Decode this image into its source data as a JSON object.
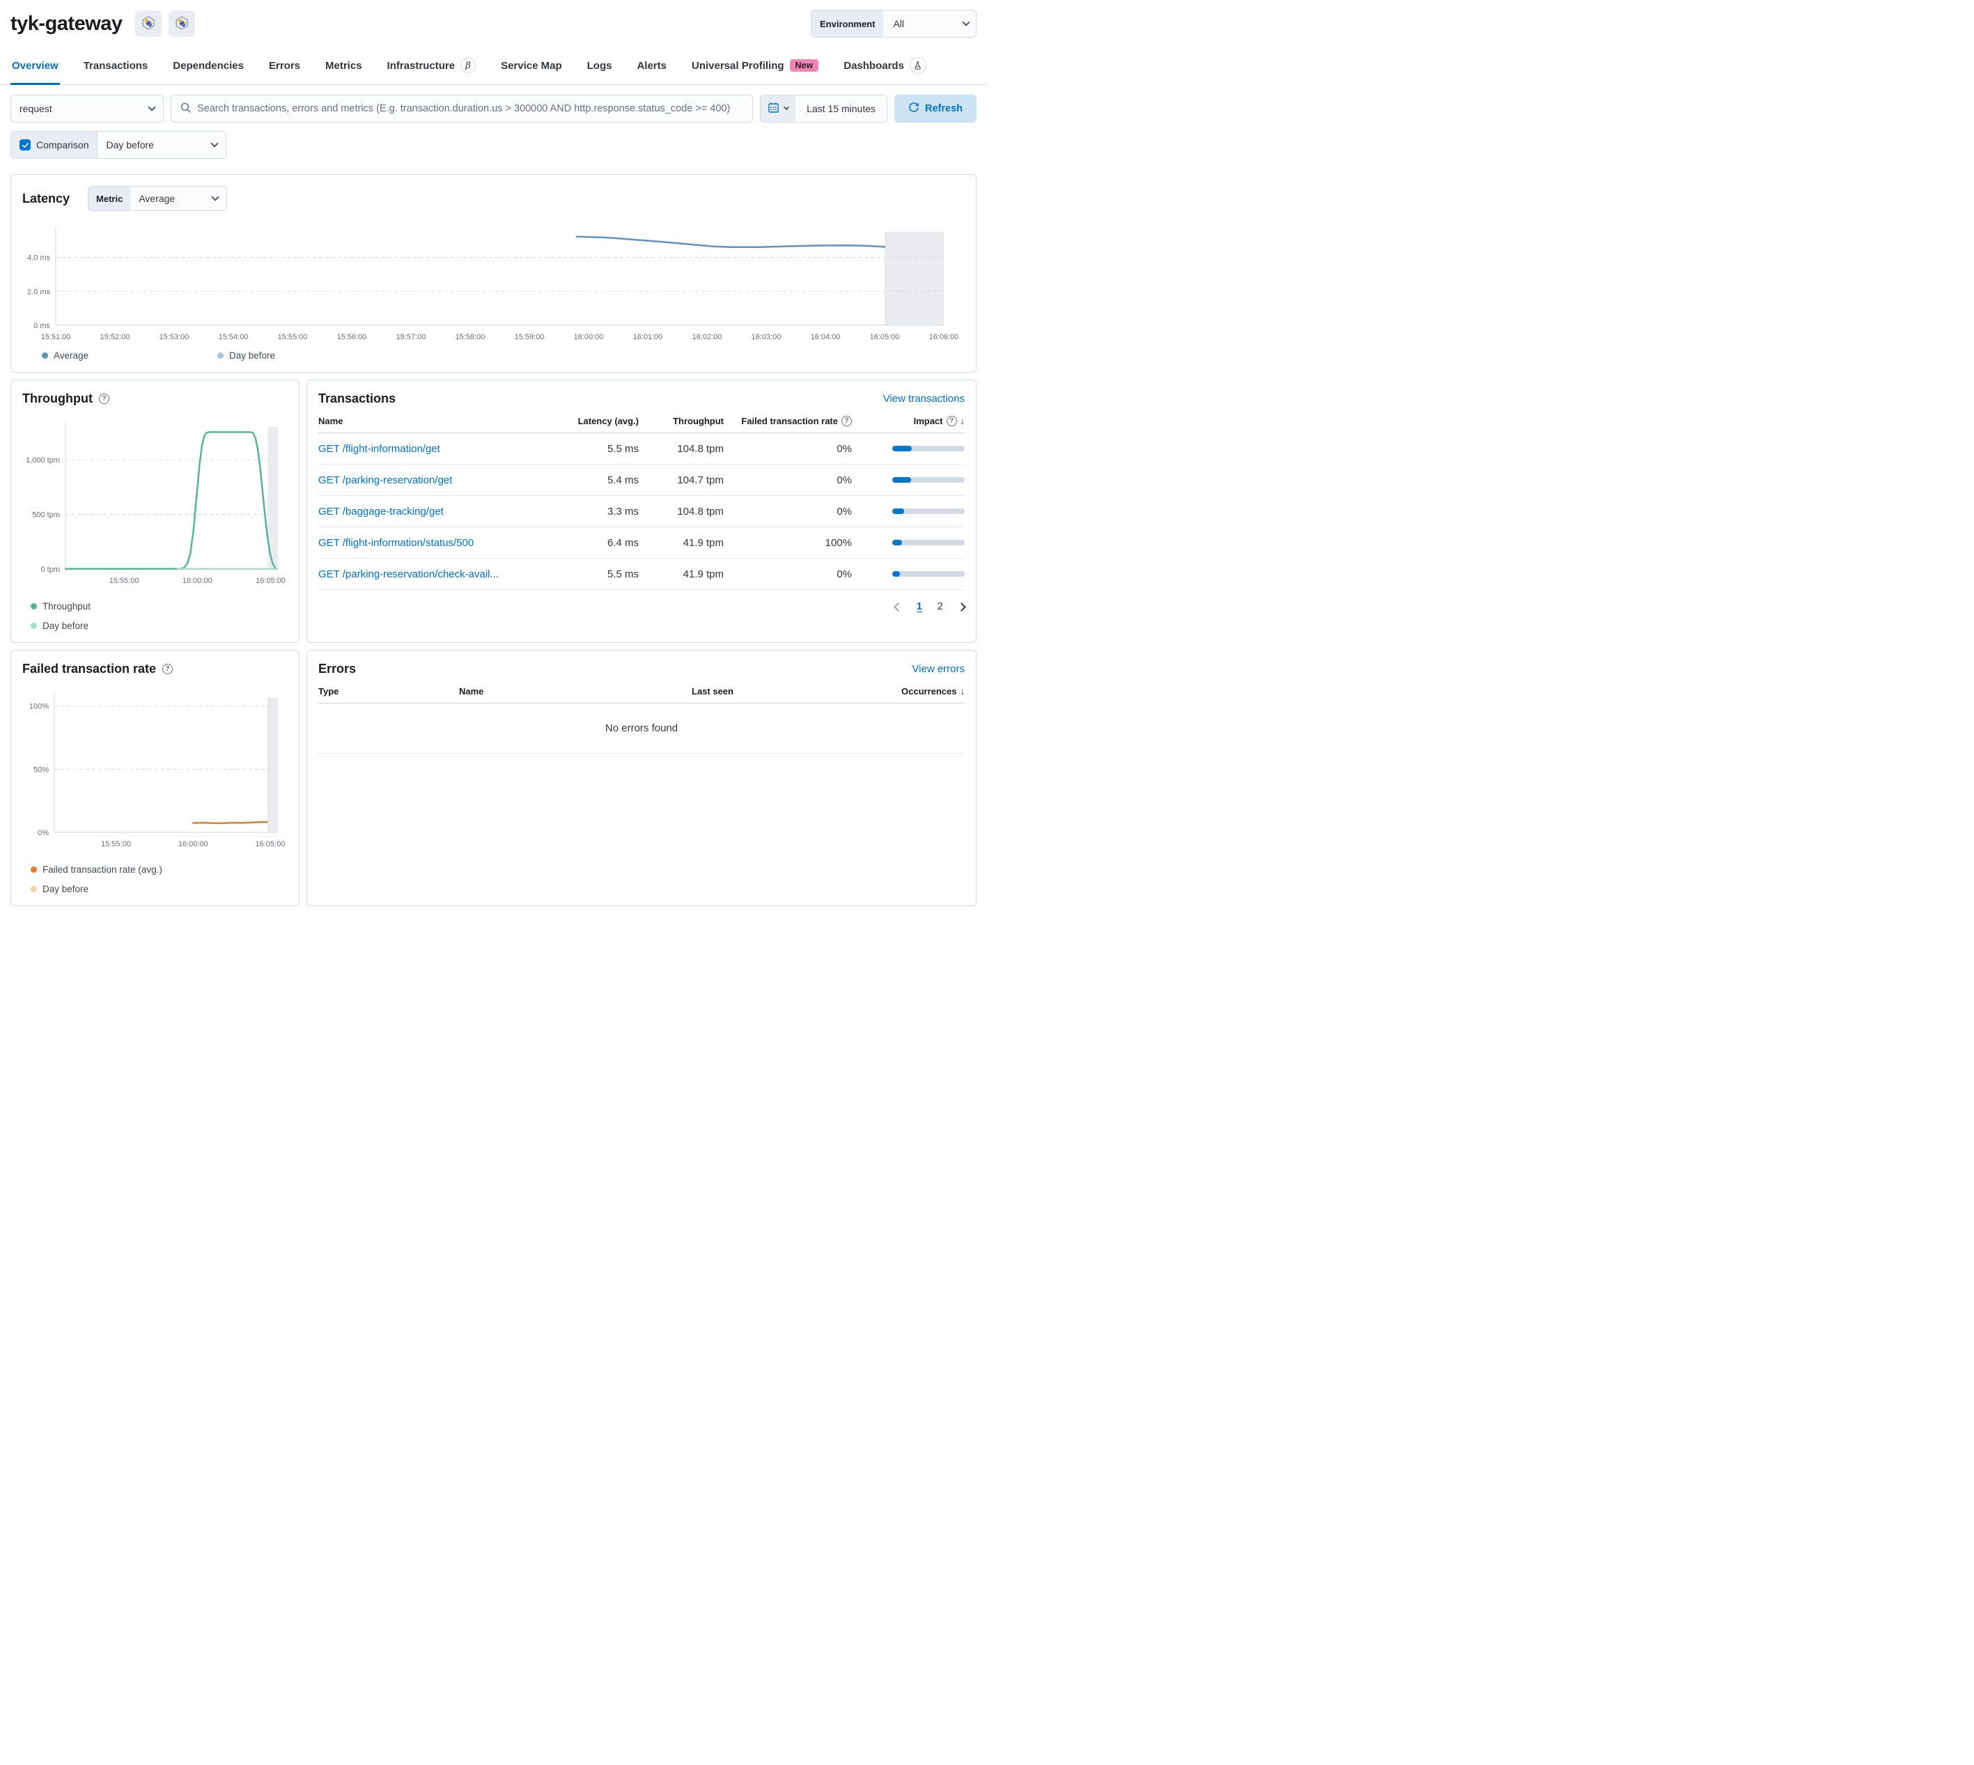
{
  "header": {
    "service_name": "tyk-gateway",
    "environment_label": "Environment",
    "environment_value": "All"
  },
  "tabs": [
    {
      "label": "Overview",
      "active": true
    },
    {
      "label": "Transactions"
    },
    {
      "label": "Dependencies"
    },
    {
      "label": "Errors"
    },
    {
      "label": "Metrics"
    },
    {
      "label": "Infrastructure",
      "beta_badge": "β"
    },
    {
      "label": "Service Map"
    },
    {
      "label": "Logs"
    },
    {
      "label": "Alerts"
    },
    {
      "label": "Universal Profiling",
      "new_badge": "New"
    },
    {
      "label": "Dashboards"
    }
  ],
  "filters": {
    "transaction_type_value": "request",
    "search_placeholder": "Search transactions, errors and metrics (E.g. transaction.duration.us > 300000 AND http.response.status_code >= 400)",
    "time_range_value": "Last 15 minutes",
    "refresh_label": "Refresh",
    "comparison_label": "Comparison",
    "comparison_checked": true,
    "comparison_value": "Day before"
  },
  "latency_panel": {
    "title": "Latency",
    "metric_label": "Metric",
    "metric_value": "Average"
  },
  "throughput_panel": {
    "title": "Throughput"
  },
  "transactions_panel": {
    "title": "Transactions",
    "view_link": "View transactions",
    "columns": {
      "name": "Name",
      "latency": "Latency (avg.)",
      "throughput": "Throughput",
      "failed_rate": "Failed transaction rate",
      "impact": "Impact"
    },
    "impact_bar_color": "#0077cc",
    "rows": [
      {
        "name": "GET /flight-information/get",
        "latency": "5.5 ms",
        "throughput": "104.8 tpm",
        "failed_rate": "0%",
        "impact_pct": 27
      },
      {
        "name": "GET /parking-reservation/get",
        "latency": "5.4 ms",
        "throughput": "104.7 tpm",
        "failed_rate": "0%",
        "impact_pct": 26
      },
      {
        "name": "GET /baggage-tracking/get",
        "latency": "3.3 ms",
        "throughput": "104.8 tpm",
        "failed_rate": "0%",
        "impact_pct": 16
      },
      {
        "name": "GET /flight-information/status/500",
        "latency": "6.4 ms",
        "throughput": "41.9 tpm",
        "failed_rate": "100%",
        "impact_pct": 13
      },
      {
        "name": "GET /parking-reservation/check-avail...",
        "latency": "5.5 ms",
        "throughput": "41.9 tpm",
        "failed_rate": "0%",
        "impact_pct": 11
      }
    ],
    "pagination": {
      "pages": [
        "1",
        "2"
      ],
      "active_page": "1"
    }
  },
  "failed_panel": {
    "title": "Failed transaction rate"
  },
  "errors_panel": {
    "title": "Errors",
    "view_link": "View errors",
    "columns": {
      "type": "Type",
      "name": "Name",
      "last_seen": "Last seen",
      "occurrences": "Occurrences"
    },
    "empty_message": "No errors found"
  },
  "chart_data": [
    {
      "id": "latency",
      "type": "line",
      "title": "Latency",
      "ylabel": "ms",
      "xlim": [
        0,
        900
      ],
      "ylim": [
        0,
        5.5
      ],
      "grid": "dashed-horizontal",
      "legend_position": "bottom",
      "yticks": [
        {
          "v": 0,
          "label": "0 ms"
        },
        {
          "v": 2,
          "label": "2.0 ms"
        },
        {
          "v": 4,
          "label": "4.0 ms"
        }
      ],
      "xticks": [
        {
          "v": 0,
          "label": "15:51:00"
        },
        {
          "v": 60,
          "label": "15:52:00"
        },
        {
          "v": 120,
          "label": "15:53:00"
        },
        {
          "v": 180,
          "label": "15:54:00"
        },
        {
          "v": 240,
          "label": "15:55:00"
        },
        {
          "v": 300,
          "label": "15:56:00"
        },
        {
          "v": 360,
          "label": "15:57:00"
        },
        {
          "v": 420,
          "label": "15:58:00"
        },
        {
          "v": 480,
          "label": "15:59:00"
        },
        {
          "v": 540,
          "label": "16:00:00"
        },
        {
          "v": 600,
          "label": "16:01:00"
        },
        {
          "v": 660,
          "label": "16:02:00"
        },
        {
          "v": 720,
          "label": "16:03:00"
        },
        {
          "v": 780,
          "label": "16:04:00"
        },
        {
          "v": 840,
          "label": "16:05:00"
        },
        {
          "v": 900,
          "label": "16:06:00"
        }
      ],
      "annotation_band": [
        840,
        900
      ],
      "series": [
        {
          "name": "Average",
          "color": "#6092c0",
          "points": [
            [
              528,
              5.22
            ],
            [
              558,
              5.17
            ],
            [
              588,
              5.04
            ],
            [
              618,
              4.9
            ],
            [
              648,
              4.74
            ],
            [
              666,
              4.65
            ],
            [
              684,
              4.61
            ],
            [
              714,
              4.61
            ],
            [
              744,
              4.66
            ],
            [
              774,
              4.7
            ],
            [
              804,
              4.71
            ],
            [
              824,
              4.68
            ],
            [
              840,
              4.62
            ]
          ]
        },
        {
          "name": "Day before",
          "color": "#a9c4df",
          "points": []
        }
      ]
    },
    {
      "id": "throughput",
      "type": "line",
      "title": "Throughput",
      "ylabel": "tpm",
      "xlim": [
        0,
        870
      ],
      "ylim": [
        0,
        1300
      ],
      "grid": "dashed-horizontal",
      "legend_position": "bottom",
      "yticks": [
        {
          "v": 0,
          "label": "0 tpm"
        },
        {
          "v": 500,
          "label": "500 tpm"
        },
        {
          "v": 1000,
          "label": "1,000 tpm"
        }
      ],
      "xticks": [
        {
          "v": 240,
          "label": "15:55:00"
        },
        {
          "v": 540,
          "label": "16:00:00"
        },
        {
          "v": 840,
          "label": "16:05:00"
        }
      ],
      "annotation_band": [
        828,
        870
      ],
      "series": [
        {
          "name": "Throughput",
          "color": "#54b399",
          "points": [
            [
              0,
              2
            ],
            [
              468,
              2
            ],
            [
              486,
              12
            ],
            [
              500,
              55
            ],
            [
              512,
              150
            ],
            [
              524,
              350
            ],
            [
              536,
              640
            ],
            [
              548,
              930
            ],
            [
              558,
              1120
            ],
            [
              568,
              1215
            ],
            [
              578,
              1248
            ],
            [
              592,
              1253
            ],
            [
              756,
              1253
            ],
            [
              768,
              1245
            ],
            [
              778,
              1200
            ],
            [
              788,
              1090
            ],
            [
              798,
              910
            ],
            [
              808,
              690
            ],
            [
              818,
              470
            ],
            [
              828,
              280
            ],
            [
              838,
              140
            ],
            [
              848,
              55
            ],
            [
              858,
              12
            ],
            [
              866,
              0
            ]
          ]
        },
        {
          "name": "Day before",
          "color": "#abdcc8",
          "points": [
            [
              462,
              1
            ],
            [
              866,
              1
            ]
          ]
        }
      ]
    },
    {
      "id": "failed_transaction_rate",
      "type": "line",
      "title": "Failed transaction rate",
      "ylabel": "%",
      "xlim": [
        0,
        870
      ],
      "ylim": [
        0,
        107
      ],
      "grid": "dashed-horizontal",
      "legend_position": "bottom",
      "yticks": [
        {
          "v": 0,
          "label": "0%"
        },
        {
          "v": 50,
          "label": "50%"
        },
        {
          "v": 100,
          "label": "100%"
        }
      ],
      "xticks": [
        {
          "v": 240,
          "label": "15:55:00"
        },
        {
          "v": 540,
          "label": "16:00:00"
        },
        {
          "v": 840,
          "label": "16:05:00"
        }
      ],
      "annotation_band": [
        828,
        870
      ],
      "series": [
        {
          "name": "Failed transaction rate (avg.)",
          "color": "#dd7e35",
          "points": [
            [
              540,
              7.4
            ],
            [
              564,
              7.5
            ],
            [
              588,
              7.6
            ],
            [
              612,
              7.35
            ],
            [
              636,
              7.2
            ],
            [
              660,
              7.3
            ],
            [
              684,
              7.5
            ],
            [
              708,
              7.55
            ],
            [
              732,
              7.5
            ],
            [
              756,
              7.7
            ],
            [
              780,
              7.9
            ],
            [
              804,
              8.1
            ],
            [
              828,
              8.1
            ]
          ]
        },
        {
          "name": "Day before",
          "color": "#f2d1ad",
          "points": []
        }
      ]
    }
  ]
}
